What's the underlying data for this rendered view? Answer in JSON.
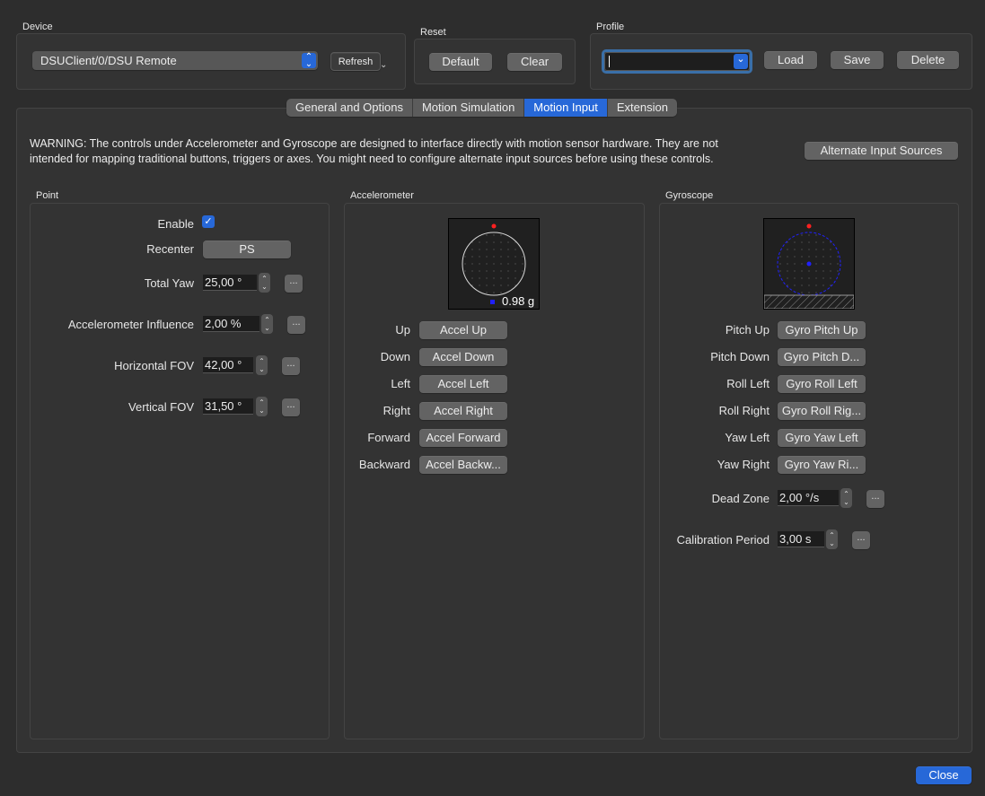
{
  "device": {
    "title": "Device",
    "selected": "DSUClient/0/DSU Remote",
    "refresh_label": "Refresh"
  },
  "reset": {
    "title": "Reset",
    "default_label": "Default",
    "clear_label": "Clear"
  },
  "profile": {
    "title": "Profile",
    "value": "",
    "load_label": "Load",
    "save_label": "Save",
    "delete_label": "Delete"
  },
  "tabs": [
    {
      "label": "General and Options",
      "active": false
    },
    {
      "label": "Motion Simulation",
      "active": false
    },
    {
      "label": "Motion Input",
      "active": true
    },
    {
      "label": "Extension",
      "active": false
    }
  ],
  "warning": {
    "line1": "WARNING: The controls under Accelerometer and Gyroscope are designed to interface directly with motion sensor hardware. They are not",
    "line2": "intended for mapping traditional buttons, triggers or axes. You might need to configure alternate input sources before using these controls.",
    "alt_sources_label": "Alternate Input Sources"
  },
  "point": {
    "title": "Point",
    "enable_label": "Enable",
    "enable_checked": true,
    "recenter_label": "Recenter",
    "recenter_value": "PS",
    "total_yaw_label": "Total Yaw",
    "total_yaw_value": "25,00 °",
    "accel_influence_label": "Accelerometer Influence",
    "accel_influence_value": "2,00 %",
    "hfov_label": "Horizontal FOV",
    "hfov_value": "42,00 °",
    "vfov_label": "Vertical FOV",
    "vfov_value": "31,50 °",
    "more_label": "..."
  },
  "accelerometer": {
    "title": "Accelerometer",
    "readout": "0.98 g",
    "bindings": [
      {
        "label": "Up",
        "value": "Accel Up"
      },
      {
        "label": "Down",
        "value": "Accel Down"
      },
      {
        "label": "Left",
        "value": "Accel Left"
      },
      {
        "label": "Right",
        "value": "Accel Right"
      },
      {
        "label": "Forward",
        "value": "Accel Forward"
      },
      {
        "label": "Backward",
        "value": "Accel Backw..."
      }
    ]
  },
  "gyroscope": {
    "title": "Gyroscope",
    "bindings": [
      {
        "label": "Pitch Up",
        "value": "Gyro Pitch Up"
      },
      {
        "label": "Pitch Down",
        "value": "Gyro Pitch D..."
      },
      {
        "label": "Roll Left",
        "value": "Gyro Roll Left"
      },
      {
        "label": "Roll Right",
        "value": "Gyro Roll Rig..."
      },
      {
        "label": "Yaw Left",
        "value": "Gyro Yaw Left"
      },
      {
        "label": "Yaw Right",
        "value": "Gyro Yaw Ri..."
      }
    ],
    "dead_zone_label": "Dead Zone",
    "dead_zone_value": "2,00 °/s",
    "calibration_label": "Calibration Period",
    "calibration_value": "3,00 s"
  },
  "close_label": "Close",
  "colors": {
    "accent": "#2768d8",
    "indicator_red": "#ff2020",
    "indicator_blue": "#2020ff"
  }
}
